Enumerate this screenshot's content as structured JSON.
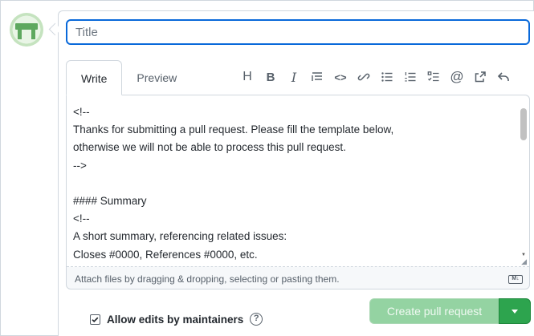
{
  "title_field": {
    "placeholder": "Title",
    "value": ""
  },
  "tabs": [
    {
      "label": "Write",
      "active": true
    },
    {
      "label": "Preview",
      "active": false
    }
  ],
  "toolbar": {
    "icons": [
      "heading-icon",
      "bold-icon",
      "italic-icon",
      "quote-icon",
      "code-icon",
      "link-icon",
      "bulleted-list-icon",
      "numbered-list-icon",
      "task-list-icon",
      "mention-icon",
      "reference-icon",
      "reply-icon"
    ],
    "heading_glyph": "H",
    "bold_glyph": "B",
    "italic_glyph": "I",
    "code_glyph": "<>",
    "mention_glyph": "@"
  },
  "editor": {
    "body": "<!--\nThanks for submitting a pull request. Please fill the template below,\notherwise we will not be able to process this pull request.\n-->\n\n#### Summary\n<!--\nA short summary, referencing related issues:\nCloses #0000, References #0000, etc.",
    "attach_hint": "Attach files by dragging & dropping, selecting or pasting them.",
    "markdown_badge": "M↓"
  },
  "options": {
    "allow_edits_label": "Allow edits by maintainers",
    "allow_edits_checked": true,
    "help_glyph": "?"
  },
  "actions": {
    "create_label": "Create pull request",
    "create_enabled": false
  },
  "colors": {
    "focus_border": "#0969da",
    "create_disabled": "#94d3a2",
    "dropdown_green": "#2da44e",
    "avatar_green": "#5ea85f"
  }
}
